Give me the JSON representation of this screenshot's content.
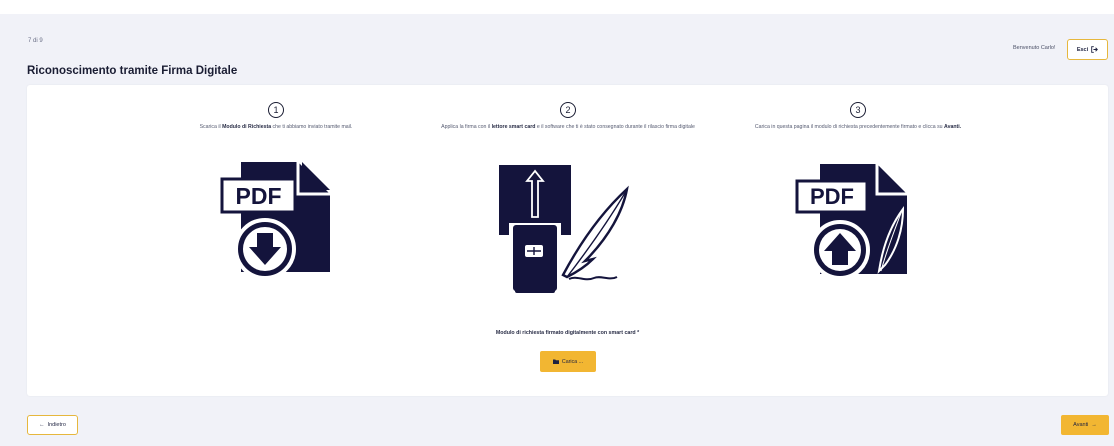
{
  "header": {
    "step_counter": "7 di 9",
    "title": "Riconoscimento tramite Firma Digitale",
    "welcome": "Benvenuto Carlo!",
    "exit_label": "Esci",
    "exit_icon": "logout-icon"
  },
  "steps": [
    {
      "number": "1",
      "text_pre": "Scarica il ",
      "text_bold": "Modulo di Richiesta",
      "text_post": " che ti abbiamo inviato tramite mail.",
      "icon": "pdf-download-icon",
      "icon_label": "PDF"
    },
    {
      "number": "2",
      "text_pre": "Applica la firma con il ",
      "text_bold": "lettore smart card",
      "text_post": " e il software che ti è stato consegnato durante il rilascio firma digitale",
      "icon": "smart-card-signature-icon"
    },
    {
      "number": "3",
      "text_pre": "Carica in questa pagina il modulo di richiesta precedentemente firmato e clicca su ",
      "text_bold": "Avanti.",
      "text_post": "",
      "icon": "pdf-upload-signed-icon",
      "icon_label": "PDF"
    }
  ],
  "upload": {
    "label": "Modulo di richiesta firmato digitalmente con smart card *",
    "button_label": "Carica ...",
    "button_icon": "folder-icon"
  },
  "footer": {
    "back_label": "Indietro",
    "back_icon": "arrow-left-icon",
    "next_label": "Avanti",
    "next_icon": "arrow-right-icon"
  },
  "colors": {
    "accent": "#f2b632",
    "icon_navy": "#14143c",
    "background": "#f1f2f8"
  }
}
